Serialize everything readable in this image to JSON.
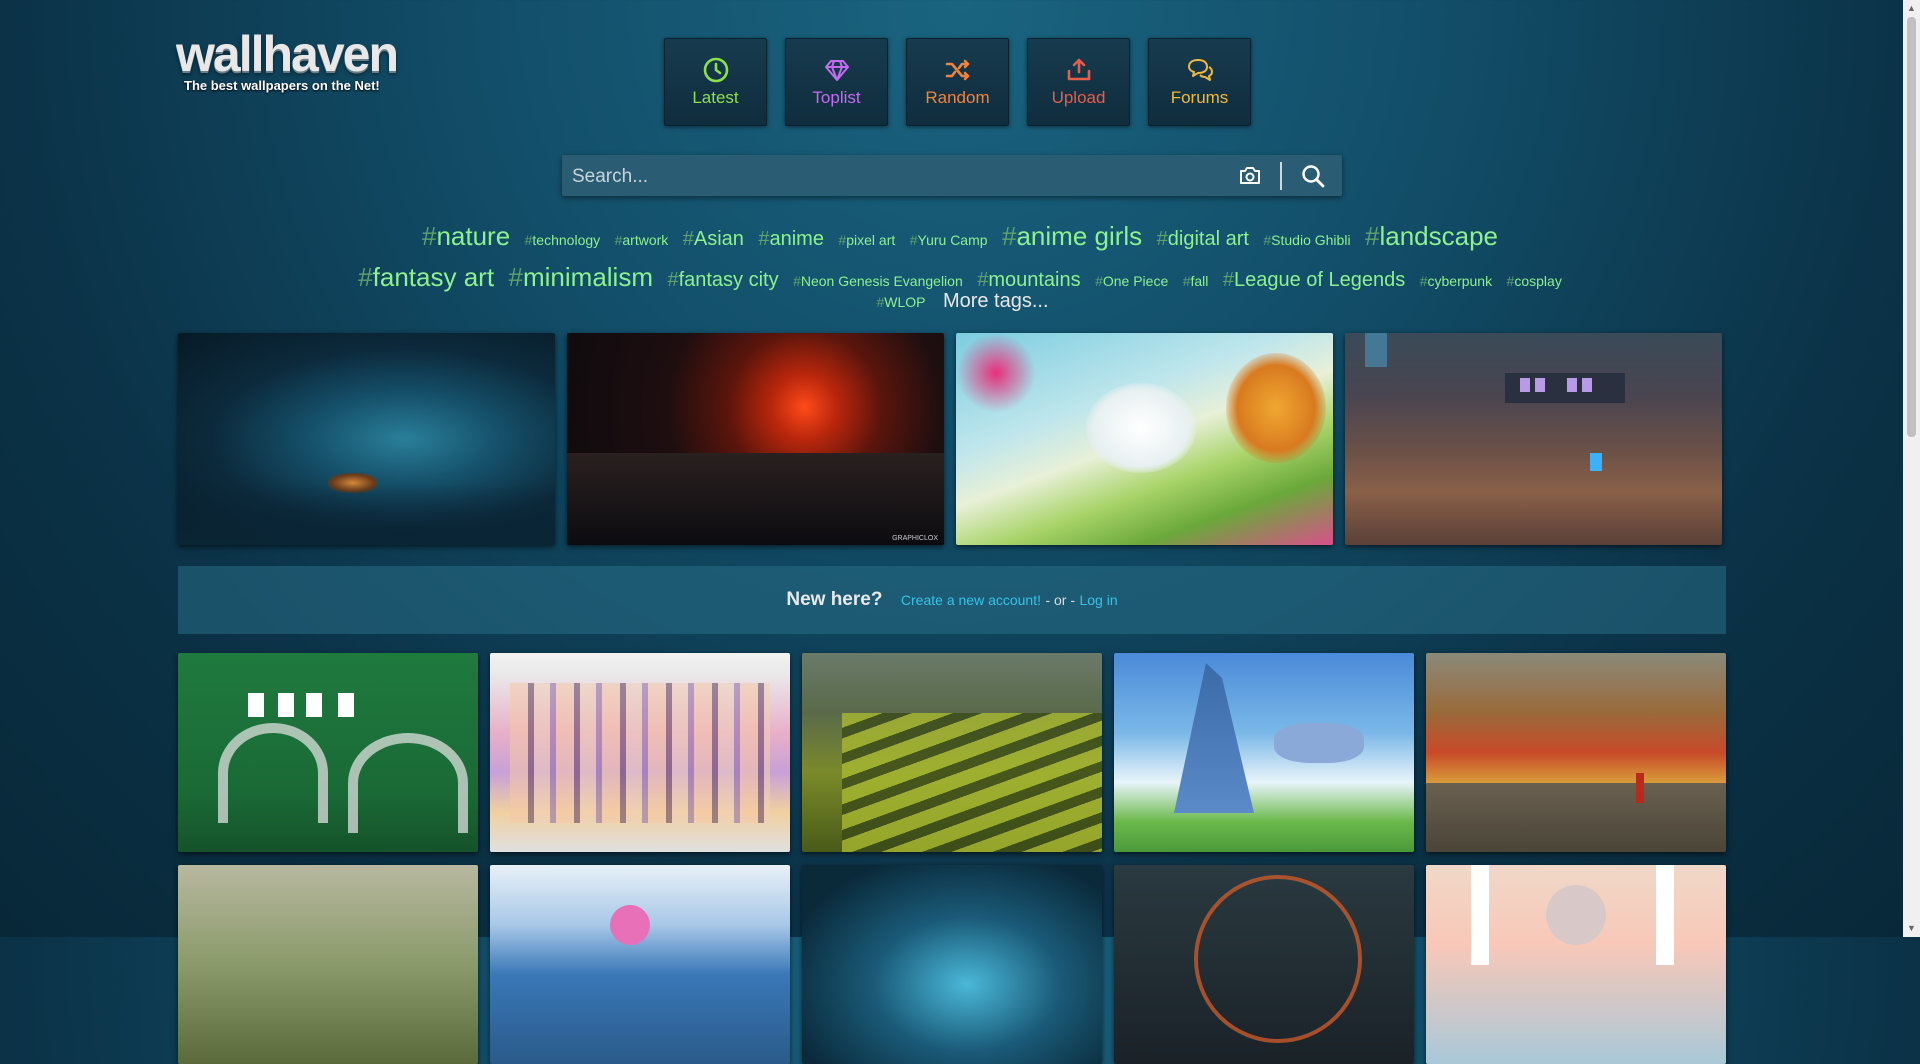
{
  "logo": {
    "title": "wallhaven",
    "subtitle": "The best wallpapers on the Net!"
  },
  "nav": [
    {
      "label": "Latest",
      "icon": "clock-icon",
      "color": "#8ee04a"
    },
    {
      "label": "Toplist",
      "icon": "diamond-icon",
      "color": "#c46bf2"
    },
    {
      "label": "Random",
      "icon": "shuffle-icon",
      "color": "#f2833a"
    },
    {
      "label": "Upload",
      "icon": "upload-icon",
      "color": "#e85c4a"
    },
    {
      "label": "Forums",
      "icon": "chat-icon",
      "color": "#f0b93a"
    }
  ],
  "search": {
    "placeholder": "Search..."
  },
  "tags": {
    "row1": [
      "nature",
      "technology",
      "artwork",
      "Asian",
      "anime",
      "pixel art",
      "Yuru Camp",
      "anime girls",
      "digital art",
      "Studio Ghibli",
      "landscape"
    ],
    "row2": [
      "fantasy art",
      "minimalism",
      "fantasy city",
      "Neon Genesis Evangelion",
      "mountains",
      "One Piece",
      "fall",
      "League of Legends",
      "cyberpunk",
      "cosplay"
    ],
    "row3": [
      "WLOP"
    ],
    "more": "More tags..."
  },
  "welcome": {
    "heading": "New here?",
    "create": "Create a new account!",
    "or": "- or -",
    "login": "Log in"
  },
  "featured_watermark": "GRAPHICLOX",
  "colors": {
    "tag": "#8ef08e",
    "link": "#35c3e8",
    "accent_bg": "#124e69"
  }
}
